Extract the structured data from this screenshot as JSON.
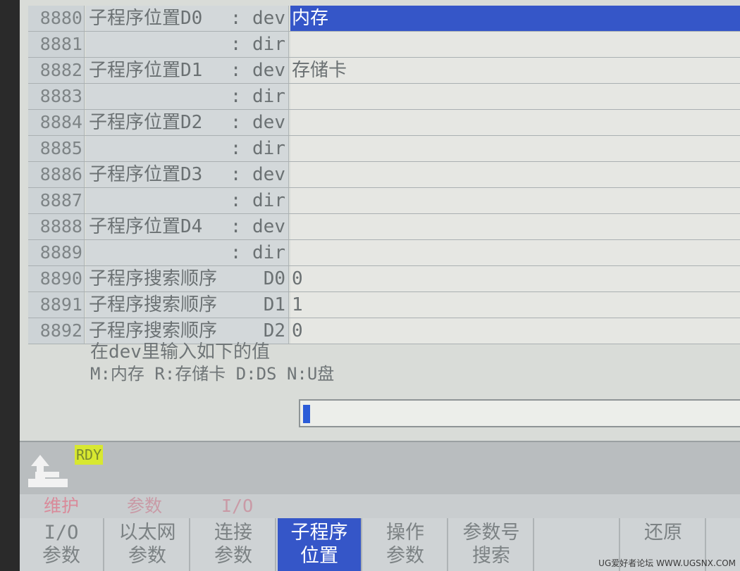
{
  "params": [
    {
      "number": "8880",
      "name": "子程序位置D0",
      "kind": ": dev",
      "value": "内存",
      "selected": true
    },
    {
      "number": "8881",
      "name": "",
      "kind": ": dir",
      "value": ""
    },
    {
      "number": "8882",
      "name": "子程序位置D1",
      "kind": ": dev",
      "value": "存储卡"
    },
    {
      "number": "8883",
      "name": "",
      "kind": ": dir",
      "value": ""
    },
    {
      "number": "8884",
      "name": "子程序位置D2",
      "kind": ": dev",
      "value": ""
    },
    {
      "number": "8885",
      "name": "",
      "kind": ": dir",
      "value": ""
    },
    {
      "number": "8886",
      "name": "子程序位置D3",
      "kind": ": dev",
      "value": ""
    },
    {
      "number": "8887",
      "name": "",
      "kind": ": dir",
      "value": ""
    },
    {
      "number": "8888",
      "name": "子程序位置D4",
      "kind": ": dev",
      "value": ""
    },
    {
      "number": "8889",
      "name": "",
      "kind": ": dir",
      "value": ""
    },
    {
      "number": "8890",
      "name": "子程序搜索顺序",
      "kind": "D0",
      "value": "0"
    },
    {
      "number": "8891",
      "name": "子程序搜索顺序",
      "kind": "D1",
      "value": "1"
    },
    {
      "number": "8892",
      "name": "子程序搜索顺序",
      "kind": "D2",
      "value": "0"
    }
  ],
  "hint": {
    "line1": "在dev里输入如下的值",
    "line2": "M:内存 R:存储卡 D:DS N:U盘"
  },
  "input": {
    "value": ""
  },
  "status": {
    "rdy": "RDY",
    "up_icon": "return-up-icon"
  },
  "groups": [
    {
      "label": "维护",
      "color": "#d98a9a"
    },
    {
      "label": "参数",
      "color": "#c99aa6"
    },
    {
      "label": "I/O",
      "color": "#c99aa6"
    }
  ],
  "softkeys": [
    {
      "line1": "I/O",
      "line2": "参数"
    },
    {
      "line1": "以太网",
      "line2": "参数"
    },
    {
      "line1": "连接",
      "line2": "参数"
    },
    {
      "line1": "子程序",
      "line2": "位置",
      "active": true
    },
    {
      "line1": "操作",
      "line2": "参数"
    },
    {
      "line1": "参数号",
      "line2": "搜索"
    },
    {
      "line1": "",
      "line2": ""
    },
    {
      "line1": "",
      "line2": "还原"
    }
  ],
  "watermark": "UG爱好者论坛 WWW.UGSNX.COM",
  "colors": {
    "selected": "#3556c8",
    "rdy": "#d8e830",
    "screen_bg": "#d9dcd8"
  }
}
